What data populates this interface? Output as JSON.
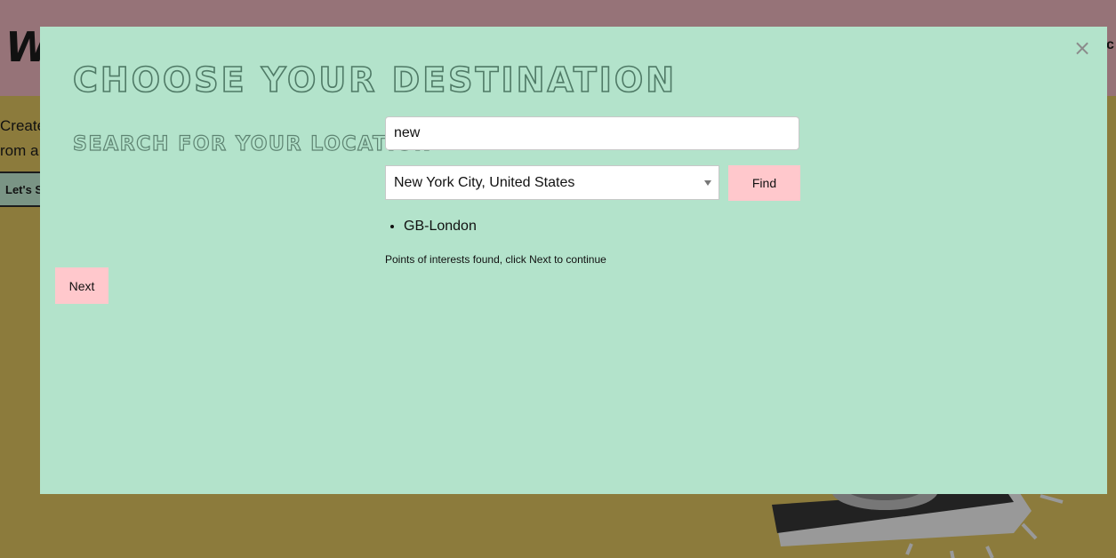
{
  "background": {
    "logo": "W",
    "nav_fragment": "c",
    "text_line1": "Create",
    "text_line2": "rom a",
    "cta_label": "Let's S"
  },
  "modal": {
    "close_glyph": "×",
    "title": "Choose your destination",
    "subtitle": "Search for your location",
    "search": {
      "value": "new",
      "placeholder": ""
    },
    "location_select": {
      "selected": "New York City, United States"
    },
    "find_label": "Find",
    "results": [
      "GB-London"
    ],
    "status": "Points of interests found, click Next to continue",
    "next_label": "Next"
  },
  "colors": {
    "modal_bg": "#b3e3cb",
    "button_bg": "#ffc8cc",
    "header_bg": "#967378",
    "page_bg": "#8c7b3c"
  }
}
